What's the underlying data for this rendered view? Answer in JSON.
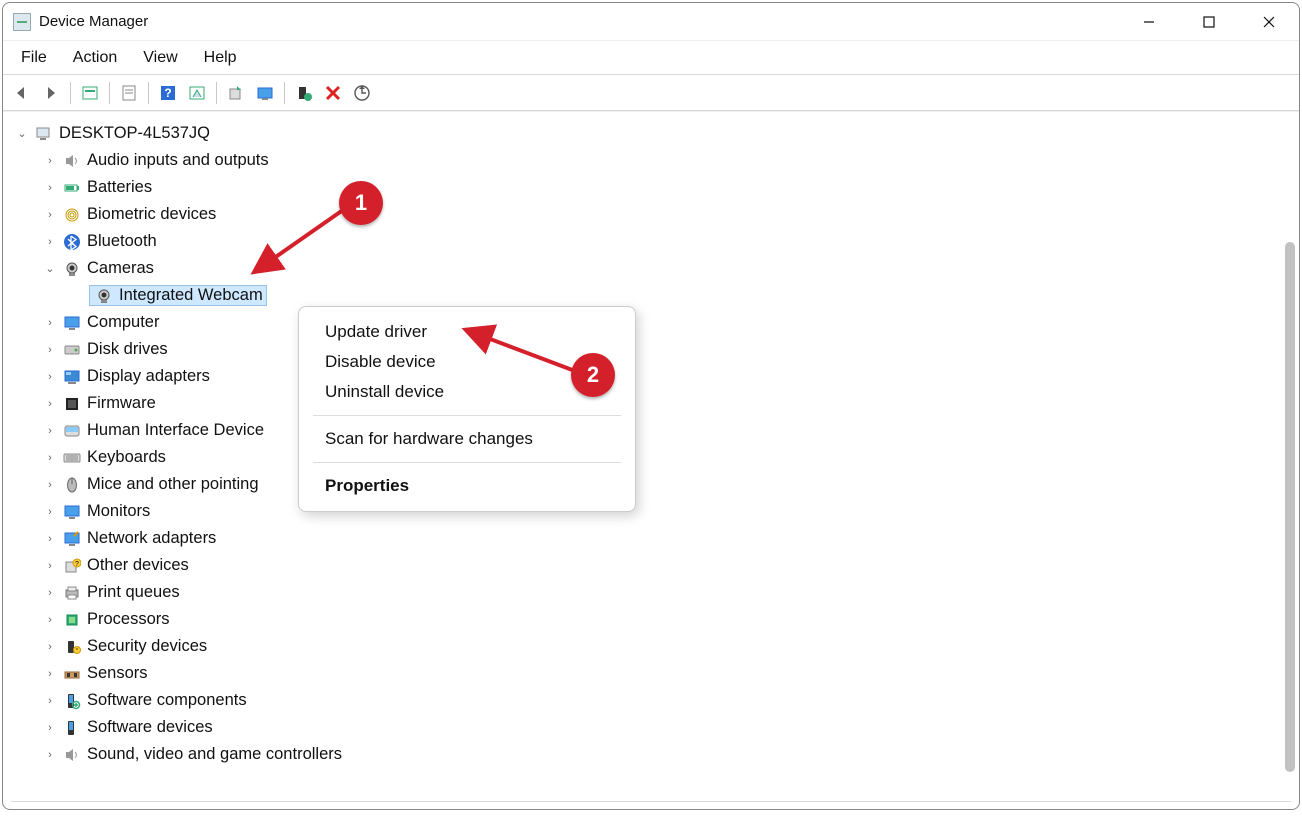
{
  "window": {
    "title": "Device Manager"
  },
  "menubar": {
    "items": [
      "File",
      "Action",
      "View",
      "Help"
    ]
  },
  "toolbar": {
    "icons": [
      "back",
      "forward",
      "show-hidden",
      "properties",
      "help",
      "action-prop",
      "update",
      "monitor",
      "enable",
      "disable",
      "scan"
    ]
  },
  "tree": {
    "root": "DESKTOP-4L537JQ",
    "nodes": [
      {
        "label": "Audio inputs and outputs",
        "icon": "speaker"
      },
      {
        "label": "Batteries",
        "icon": "battery"
      },
      {
        "label": "Biometric devices",
        "icon": "fingerprint"
      },
      {
        "label": "Bluetooth",
        "icon": "bluetooth"
      },
      {
        "label": "Cameras",
        "icon": "camera",
        "expanded": true,
        "children": [
          {
            "label": "Integrated Webcam",
            "icon": "webcam",
            "selected": true
          }
        ]
      },
      {
        "label": "Computer",
        "icon": "monitor"
      },
      {
        "label": "Disk drives",
        "icon": "disk"
      },
      {
        "label": "Display adapters",
        "icon": "display"
      },
      {
        "label": "Firmware",
        "icon": "firmware"
      },
      {
        "label": "Human Interface Device",
        "icon": "hid",
        "truncated": true
      },
      {
        "label": "Keyboards",
        "icon": "keyboard"
      },
      {
        "label": "Mice and other pointing",
        "icon": "mouse",
        "truncated": true
      },
      {
        "label": "Monitors",
        "icon": "monitor2"
      },
      {
        "label": "Network adapters",
        "icon": "network"
      },
      {
        "label": "Other devices",
        "icon": "other"
      },
      {
        "label": "Print queues",
        "icon": "printer"
      },
      {
        "label": "Processors",
        "icon": "cpu"
      },
      {
        "label": "Security devices",
        "icon": "security"
      },
      {
        "label": "Sensors",
        "icon": "sensor"
      },
      {
        "label": "Software components",
        "icon": "swcomp"
      },
      {
        "label": "Software devices",
        "icon": "swdev"
      },
      {
        "label": "Sound, video and game controllers",
        "icon": "sound"
      }
    ]
  },
  "context_menu": {
    "groups": [
      [
        "Update driver",
        "Disable device",
        "Uninstall device"
      ],
      [
        "Scan for hardware changes"
      ],
      [
        "Properties"
      ]
    ],
    "bold_item": "Properties"
  },
  "annotations": {
    "badge1": "1",
    "badge2": "2"
  }
}
